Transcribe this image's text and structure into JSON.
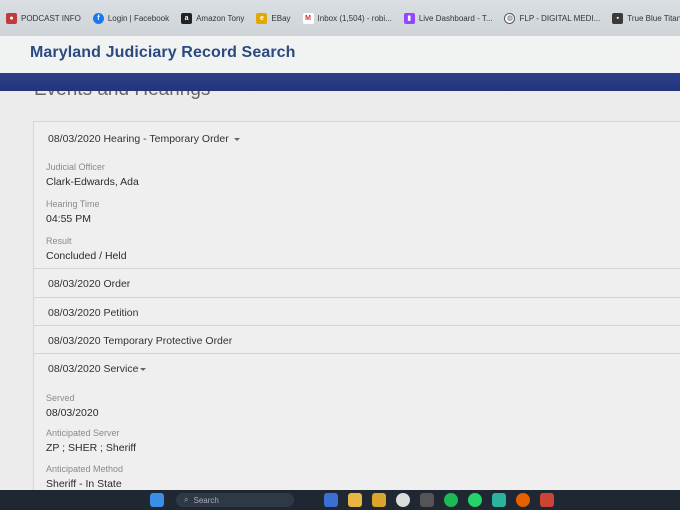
{
  "bookmarks": [
    {
      "label": "PODCAST INFO",
      "icon": "podcast-icon",
      "color": "#c23b3b"
    },
    {
      "label": "Login | Facebook",
      "icon": "facebook-icon",
      "color": "#1877f2"
    },
    {
      "label": "Amazon Tony",
      "icon": "amazon-icon",
      "color": "#222222"
    },
    {
      "label": "EBay",
      "icon": "ebay-icon",
      "color": "#e0a800"
    },
    {
      "label": "Inbox (1,504) - robi...",
      "icon": "gmail-icon",
      "color": "#d93025"
    },
    {
      "label": "Live Dashboard - T...",
      "icon": "twitch-icon",
      "color": "#9146ff"
    },
    {
      "label": "FLP - DIGITAL MEDI...",
      "icon": "globe-icon",
      "color": "#555555"
    },
    {
      "label": "True Blue Titanium -...",
      "icon": "bookmark-icon",
      "color": "#3a3a3a"
    }
  ],
  "site": {
    "title": "Maryland Judiciary Record Search"
  },
  "section": {
    "heading": "Events and Hearings"
  },
  "events": {
    "hearing_header": "08/03/2020 Hearing - Temporary Order",
    "hearing_details": [
      {
        "label": "Judicial Officer",
        "value": "Clark-Edwards, Ada"
      },
      {
        "label": "Hearing Time",
        "value": "04:55 PM"
      },
      {
        "label": "Result",
        "value": "Concluded / Held"
      }
    ],
    "rows": [
      "08/03/2020 Order",
      "08/03/2020 Petition",
      "08/03/2020 Temporary Protective Order"
    ],
    "service_header": "08/03/2020 Service",
    "service_details": [
      {
        "label": "Served",
        "value": "08/03/2020"
      },
      {
        "label": "Anticipated Server",
        "value": "ZP ; SHER ; Sheriff"
      },
      {
        "label": "Anticipated Method",
        "value": "Sheriff - In State"
      }
    ]
  },
  "taskbar": {
    "search_placeholder": "Search"
  },
  "colors": {
    "brand_blue": "#2a4a80",
    "bar_blue": "#2d3f8a"
  }
}
